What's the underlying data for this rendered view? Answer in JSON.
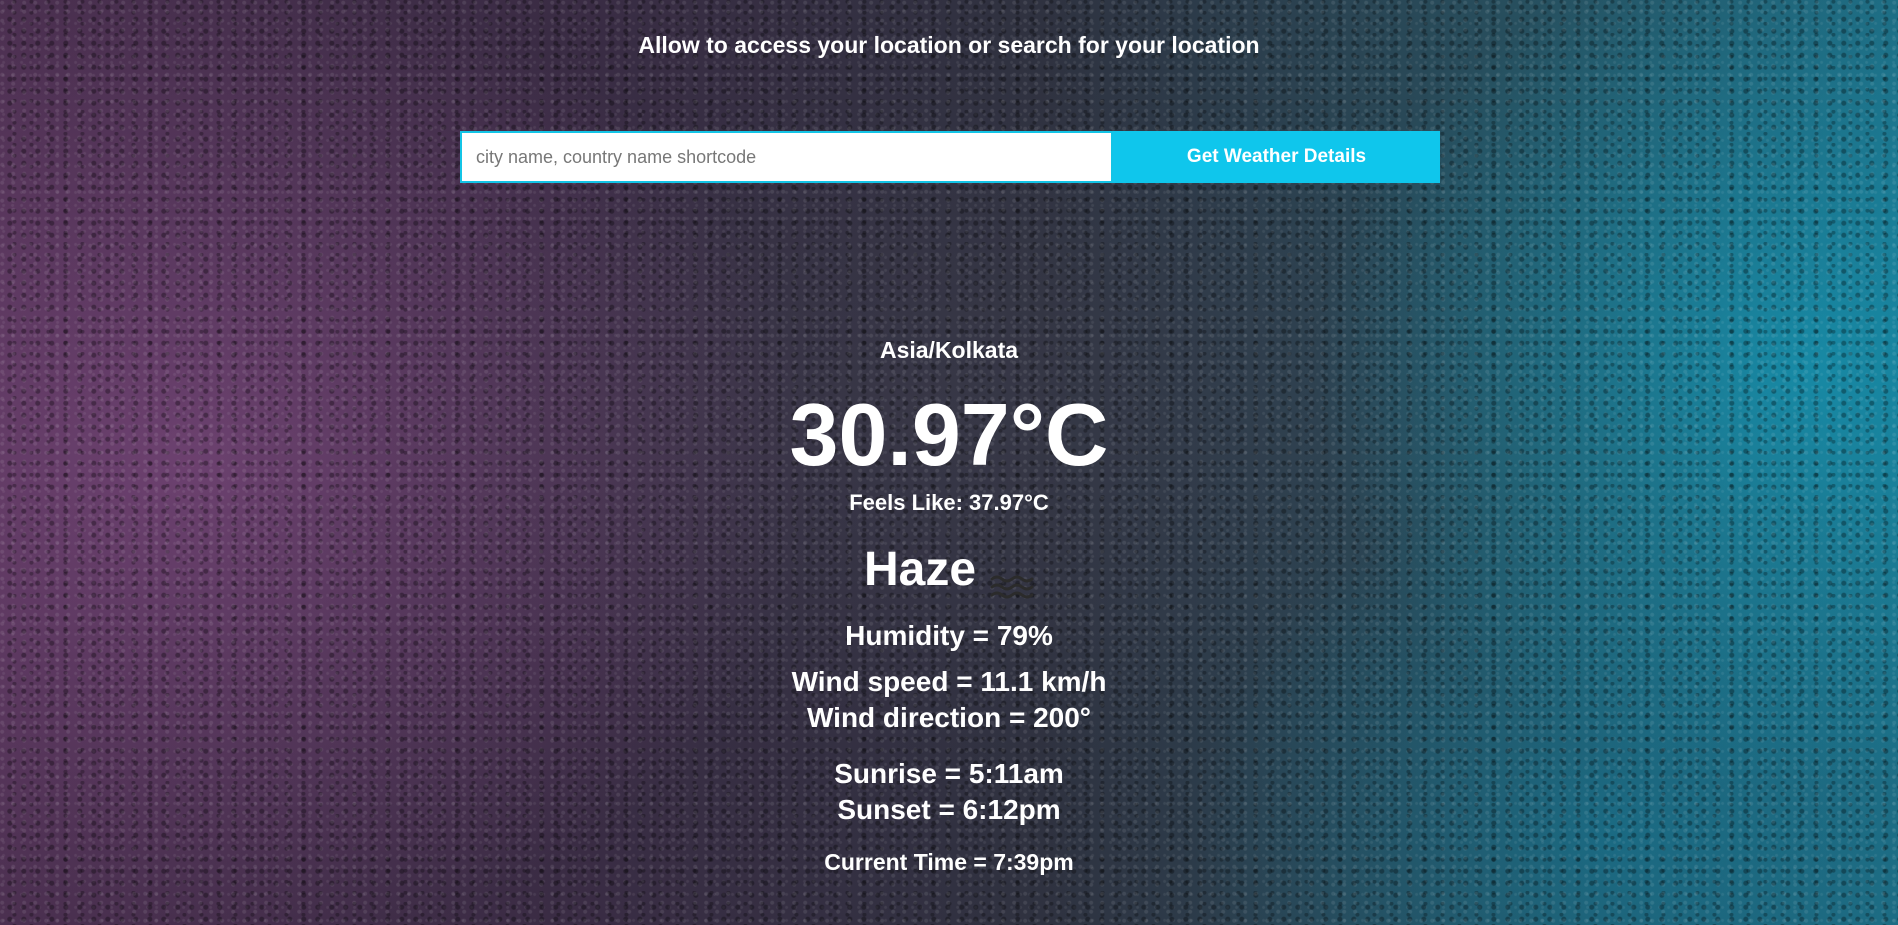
{
  "header": {
    "prompt": "Allow to access your location or search for your location"
  },
  "search": {
    "placeholder": "city name, country name shortcode",
    "value": "",
    "button_label": "Get Weather Details"
  },
  "weather": {
    "timezone": "Asia/Kolkata",
    "temperature": "30.97°C",
    "feels_like": "Feels Like: 37.97°C",
    "condition": "Haze",
    "condition_icon": "haze-icon",
    "humidity": "Humidity = 79%",
    "wind_speed": "Wind speed = 11.1 km/h",
    "wind_direction": "Wind direction = 200°",
    "sunrise": "Sunrise = 5:11am",
    "sunset": "Sunset = 6:12pm",
    "current_time": "Current Time = 7:39pm"
  },
  "colors": {
    "accent": "#0fc6ec",
    "text": "#ffffff"
  }
}
